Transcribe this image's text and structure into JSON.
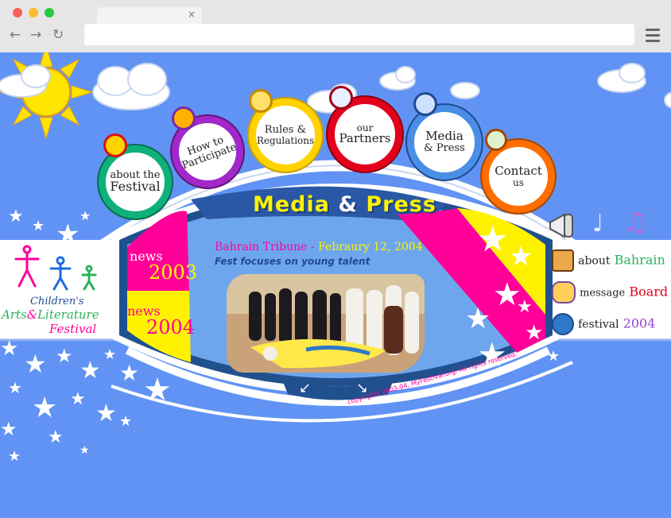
{
  "browser": {
    "tab_close": "×",
    "back": "←",
    "forward": "→",
    "reload": "↻"
  },
  "nav": [
    {
      "line1": "about the",
      "line2": "Festival"
    },
    {
      "line1": "How to",
      "line2": "Participate"
    },
    {
      "line1": "Rules &",
      "line2": "Regulations"
    },
    {
      "line1": "our",
      "line2": "Partners"
    },
    {
      "line1": "Media",
      "line2": "& Press"
    },
    {
      "line1": "Contact",
      "line2": "us"
    }
  ],
  "logo": {
    "line1": "Children's",
    "line2_a": "Arts",
    "line2_amp": "&",
    "line2_b": "Literature",
    "line3": "Festival"
  },
  "section_title": {
    "part1": "Media",
    "amp": "&",
    "part2": "Press"
  },
  "article": {
    "source": "Bahrain Tribune",
    "sep": " - ",
    "date": "Febraury 12, 2004",
    "headline": "Fest focuses on young talent"
  },
  "news": [
    {
      "word": "news",
      "year": "2003"
    },
    {
      "word": "news",
      "year": "2004"
    }
  ],
  "right_links": [
    {
      "a": "about",
      "b": "Bahrain"
    },
    {
      "a": "message",
      "b": "Board"
    },
    {
      "a": "festival",
      "b": "2004"
    }
  ],
  "pager": {
    "prev": "↙",
    "next": "↘"
  },
  "copyright": "copyrights 2003-04, MyFestival.org. All rights reserved.",
  "colors": {
    "sky": "#6193f4",
    "magenta": "#ff0099",
    "yellow": "#ffee00",
    "navy": "#1f4a90",
    "title_yellow": "#fff200"
  }
}
